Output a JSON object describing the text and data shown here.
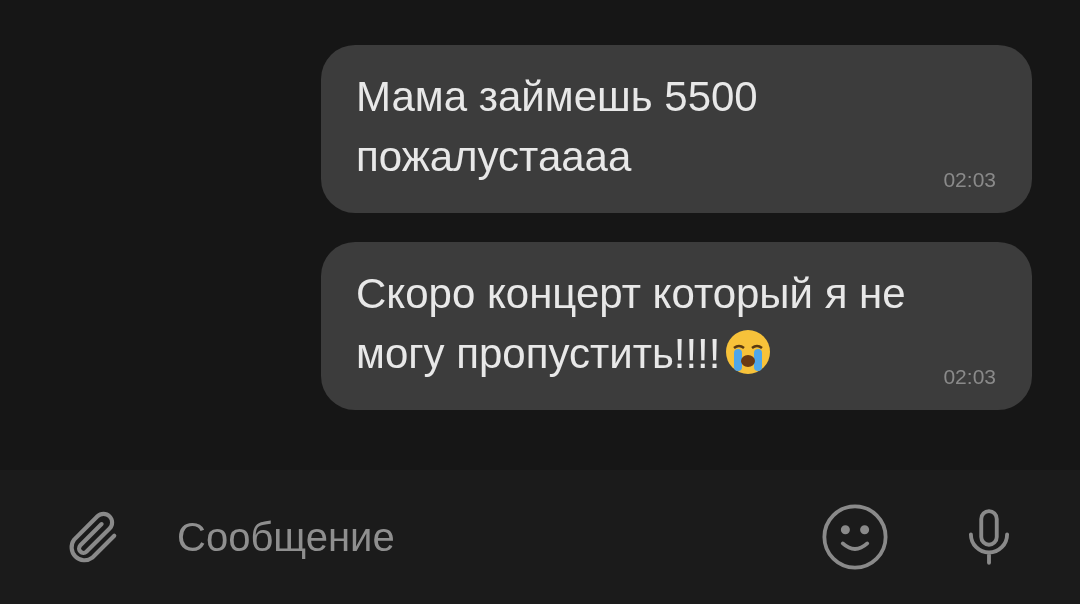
{
  "messages": [
    {
      "text": "Мама займешь 5500 пожалустаааа",
      "time": "02:03",
      "emoji": false
    },
    {
      "text": "Скоро концерт который я не могу пропустить!!!!",
      "time": "02:03",
      "emoji": true
    }
  ],
  "composer": {
    "placeholder": "Сообщение"
  }
}
